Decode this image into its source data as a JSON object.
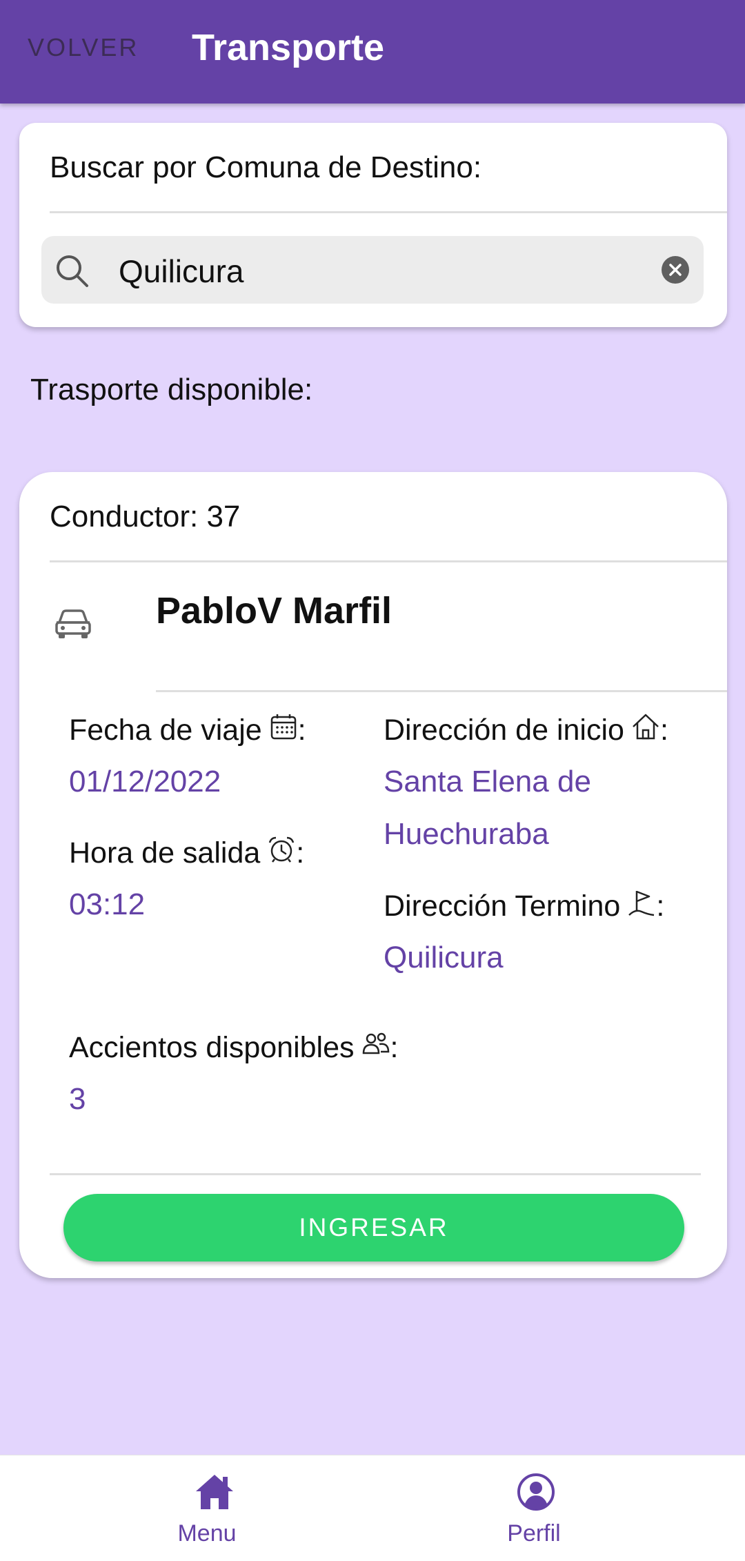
{
  "header": {
    "back_label": "VOLVER",
    "title": "Transporte"
  },
  "search": {
    "label": "Buscar por Comuna de Destino:",
    "value": "Quilicura"
  },
  "section_label": "Trasporte disponible:",
  "ride": {
    "driver_label": "Conductor: 37",
    "driver_name": "PabloV Marfil",
    "fecha_label": "Fecha de viaje",
    "fecha_value": "01/12/2022",
    "hora_label": "Hora de salida",
    "hora_value": "03:12",
    "inicio_label": "Dirección de inicio",
    "inicio_value": "Santa Elena de Huechuraba",
    "termino_label": "Dirección Termino",
    "termino_value": "Quilicura",
    "asientos_label": "Accientos disponibles",
    "asientos_value": "3",
    "colon": ":",
    "join_label": "INGRESAR"
  },
  "tabs": {
    "menu_label": "Menu",
    "perfil_label": "Perfil"
  },
  "colors": {
    "primary": "#6442a6",
    "background": "#e3d5fd",
    "success": "#2dd36f"
  },
  "icons": {
    "search": "search-icon",
    "clear": "close-circle-icon",
    "car": "car-icon",
    "calendar": "calendar-icon",
    "alarm": "alarm-clock-icon",
    "home": "home-icon",
    "flag": "flag-icon",
    "people": "people-icon",
    "menu": "home-icon",
    "perfil": "person-circle-icon"
  }
}
